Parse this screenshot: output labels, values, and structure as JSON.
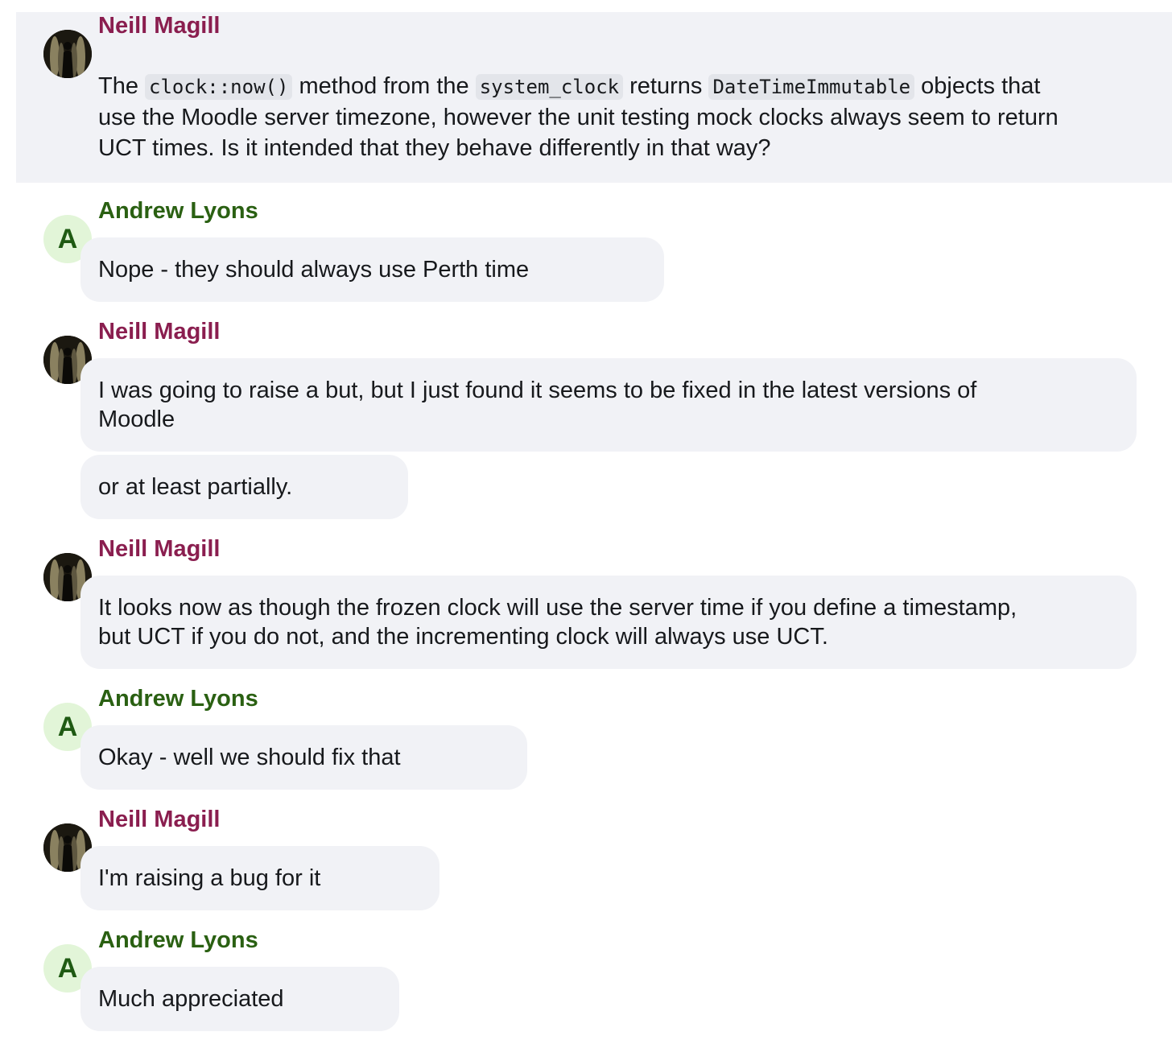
{
  "messages": [
    {
      "sender": "Neill Magill",
      "parts": {
        "t1": "The ",
        "c1": "clock::now()",
        "t2": " method from the ",
        "c2": "system_clock",
        "t3": " returns ",
        "c3": "DateTimeImmutable",
        "t4": " objects that use the Moodle server timezone, however the unit testing mock clocks always seem to return UCT times. Is it intended that they behave differently in that way?"
      }
    },
    {
      "sender": "Andrew Lyons",
      "avatar_letter": "A",
      "bubbles": [
        "Nope - they should always use Perth time"
      ]
    },
    {
      "sender": "Neill Magill",
      "bubbles": [
        "I was going to raise a but, but I just found it seems to be fixed in the latest versions of Moodle",
        "or at least partially."
      ]
    },
    {
      "sender": "Neill Magill",
      "bubbles": [
        "It looks now as though the frozen clock will use the server time if you define a timestamp, but UCT if you do not, and the incrementing clock will always use UCT."
      ]
    },
    {
      "sender": "Andrew Lyons",
      "avatar_letter": "A",
      "bubbles": [
        "Okay - well we should fix that"
      ]
    },
    {
      "sender": "Neill Magill",
      "bubbles": [
        "I'm raising a bug for it"
      ]
    },
    {
      "sender": "Andrew Lyons",
      "avatar_letter": "A",
      "bubbles": [
        "Much appreciated"
      ]
    }
  ],
  "colors": {
    "neill_name": "#8a1e4f",
    "andrew_name": "#2a6012",
    "bubble_bg": "#f1f2f6",
    "letter_avatar_bg": "#e2f5d8"
  }
}
